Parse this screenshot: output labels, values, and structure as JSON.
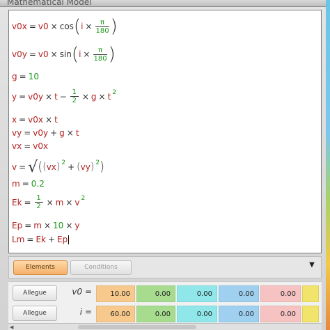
{
  "window": {
    "title": "Mathematical Model"
  },
  "equations": [
    {
      "id": "v0x",
      "text": "v0x = v0 × cos(i × π/180)"
    },
    {
      "id": "v0y",
      "text": "v0y = v0 × sin(i × π/180)"
    },
    {
      "id": "g",
      "text": "g = 10"
    },
    {
      "id": "y",
      "text": "y = v0y × t − 1/2 × g × t²"
    },
    {
      "id": "x",
      "text": "x = v0x × t"
    },
    {
      "id": "vy",
      "text": "vy = v0y + g × t"
    },
    {
      "id": "vx",
      "text": "vx = v0x"
    },
    {
      "id": "v",
      "text": "v = √((vx)² + (vy)²)"
    },
    {
      "id": "m",
      "text": "m = 0.2"
    },
    {
      "id": "Ek",
      "text": "Ek = 1/2 × m × v²"
    },
    {
      "id": "Ep",
      "text": "Ep = m × 10 × y"
    },
    {
      "id": "Lm",
      "text": "Lm = Ek + Ep"
    }
  ],
  "eq_parts": {
    "v0x_lhs": "v0x",
    "v0x_a": "v0",
    "cos": "cos",
    "i": "i",
    "pi": "π",
    "n180": "180",
    "v0y_lhs": "v0y",
    "v0y_a": "v0",
    "sin": "sin",
    "g_lhs": "g",
    "g_val": "10",
    "y_lhs": "y",
    "y_a": "v0y",
    "t": "t",
    "half_num": "1",
    "half_den": "2",
    "gv": "g",
    "tv": "t",
    "two": "2",
    "x_lhs": "x",
    "x_a": "v0x",
    "x_t": "t",
    "vy_lhs": "vy",
    "vy_a": "v0y",
    "vy_g": "g",
    "vy_t": "t",
    "vx_lhs": "vx",
    "vx_a": "v0x",
    "v_lhs": "v",
    "v_vx": "vx",
    "v_vy": "vy",
    "v_sq1": "2",
    "v_sq2": "2",
    "m_lhs": "m",
    "m_val": "0.2",
    "ek_lhs": "Ek",
    "ek_num": "1",
    "ek_den": "2",
    "ek_m": "m",
    "ek_v": "v",
    "ek_sq": "2",
    "ep_lhs": "Ep",
    "ep_m": "m",
    "ep_10": "10",
    "ep_y": "y",
    "lm_lhs": "Lm",
    "lm_ek": "Ek",
    "lm_ep": "Ep"
  },
  "toolbar": {
    "elements_label": "Elements",
    "conditions_label": "Conditions",
    "dropdown_icon": "▼"
  },
  "grid": {
    "rows": [
      {
        "button": "Allegue",
        "var": "v0",
        "values": [
          "10.00",
          "0.00",
          "0.00",
          "0.00",
          "0.00"
        ]
      },
      {
        "button": "Allegue",
        "var": "i",
        "values": [
          "60.00",
          "0.00",
          "0.00",
          "0.00",
          "0.00"
        ]
      }
    ],
    "cell_colors": [
      "#f7c98c",
      "#a7dc8f",
      "#8fe7ea",
      "#9fd0f0",
      "#f6c2c2",
      "#f2e36a"
    ]
  }
}
